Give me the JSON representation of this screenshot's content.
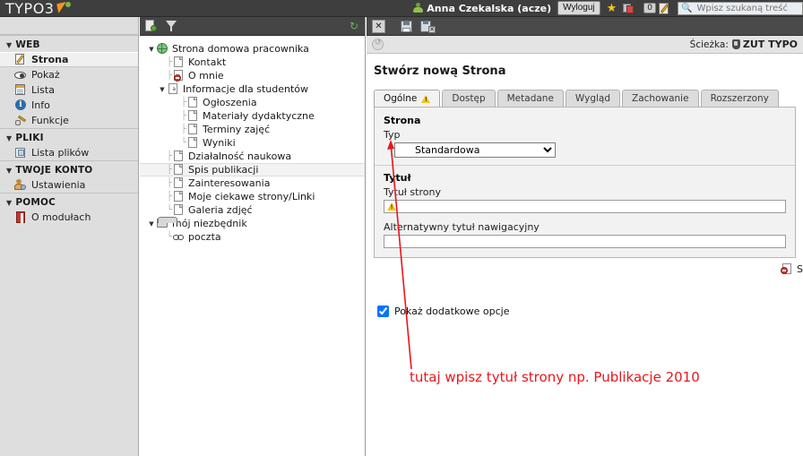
{
  "header": {
    "logo_text": "TYPO3",
    "logo_icon": "typo3-logo-icon",
    "user_icon": "user-icon",
    "user_name": "Anna Czekalska (acze)",
    "logout_label": "Wyloguj",
    "bookmark_icon": "star-icon",
    "clipboard_icon": "clipboard-icon",
    "clipboard_count": "0",
    "edit_icon": "pencil-icon",
    "search_icon": "search-icon",
    "search_placeholder": "Wpisz szukaną treść",
    "search_value": ""
  },
  "sidebar": {
    "groups": [
      {
        "label": "WEB",
        "items": [
          {
            "label": "Strona",
            "icon": "page-edit-icon",
            "selected": true
          },
          {
            "label": "Pokaż",
            "icon": "eye-icon",
            "selected": false
          },
          {
            "label": "Lista",
            "icon": "list-icon",
            "selected": false
          },
          {
            "label": "Info",
            "icon": "info-icon",
            "selected": false
          },
          {
            "label": "Funkcje",
            "icon": "wrench-icon",
            "selected": false
          }
        ]
      },
      {
        "label": "PLIKI",
        "items": [
          {
            "label": "Lista plików",
            "icon": "file-list-icon",
            "selected": false
          }
        ]
      },
      {
        "label": "TWOJE KONTO",
        "items": [
          {
            "label": "Ustawienia",
            "icon": "user-settings-icon",
            "selected": false
          }
        ]
      },
      {
        "label": "POMOC",
        "items": [
          {
            "label": "O modułach",
            "icon": "book-icon",
            "selected": false
          }
        ]
      }
    ]
  },
  "tree": {
    "toolbar": {
      "new_page_icon": "new-page-icon",
      "filter_icon": "filter-icon",
      "refresh_icon": "refresh-icon"
    },
    "nodes": [
      {
        "label": "Strona domowa pracownika",
        "icon": "globe-icon",
        "depth": 0,
        "toggle": "▼",
        "selected": false
      },
      {
        "label": "Kontakt",
        "icon": "page-icon",
        "depth": 1,
        "toggle": "",
        "selected": false
      },
      {
        "label": "O mnie",
        "icon": "page-hidden-icon",
        "depth": 1,
        "toggle": "",
        "selected": false
      },
      {
        "label": "Informacje dla studentów",
        "icon": "page-alias-icon",
        "depth": 1,
        "toggle": "▼",
        "selected": false
      },
      {
        "label": "Ogłoszenia",
        "icon": "page-icon",
        "depth": 2,
        "toggle": "",
        "selected": false
      },
      {
        "label": "Materiały dydaktyczne",
        "icon": "page-icon",
        "depth": 2,
        "toggle": "",
        "selected": false
      },
      {
        "label": "Terminy zajęć",
        "icon": "page-icon",
        "depth": 2,
        "toggle": "",
        "selected": false
      },
      {
        "label": "Wyniki",
        "icon": "page-icon",
        "depth": 2,
        "toggle": "",
        "selected": false
      },
      {
        "label": "Działalność naukowa",
        "icon": "page-icon",
        "depth": 1,
        "toggle": "",
        "selected": false
      },
      {
        "label": "Spis publikacji",
        "icon": "page-icon",
        "depth": 1,
        "toggle": "",
        "selected": true
      },
      {
        "label": "Zainteresowania",
        "icon": "page-icon",
        "depth": 1,
        "toggle": "",
        "selected": false
      },
      {
        "label": "Moje ciekawe strony/Linki",
        "icon": "page-icon",
        "depth": 1,
        "toggle": "",
        "selected": false
      },
      {
        "label": "Galeria zdjęć",
        "icon": "page-icon",
        "depth": 1,
        "toggle": "",
        "selected": false
      },
      {
        "label": "mój niezbędnik",
        "icon": "folder-icon",
        "depth": 0,
        "toggle": "▼",
        "selected": false
      },
      {
        "label": "poczta",
        "icon": "link-icon",
        "depth": 1,
        "toggle": "",
        "selected": false
      }
    ]
  },
  "doc": {
    "toolbar": {
      "close_icon": "close-icon",
      "close_label": "✕",
      "save_icon": "save-icon",
      "save_close_icon": "save-and-close-icon"
    },
    "pathbar": {
      "history_icon": "history-icon",
      "path_label": "Ścieżka:",
      "site_icon": "site-shield-icon",
      "site_name": "ZUT TYPO"
    },
    "title": "Stwórz nową Strona",
    "tabs": [
      {
        "label": "Ogólne",
        "active": true,
        "warning": true
      },
      {
        "label": "Dostęp",
        "active": false,
        "warning": false
      },
      {
        "label": "Metadane",
        "active": false,
        "warning": false
      },
      {
        "label": "Wygląd",
        "active": false,
        "warning": false
      },
      {
        "label": "Zachowanie",
        "active": false,
        "warning": false
      },
      {
        "label": "Rozszerzony",
        "active": false,
        "warning": false
      }
    ],
    "form": {
      "section_page_label": "Strona",
      "type_label": "Typ",
      "type_value": "Standardowa",
      "type_options": [
        "Standardowa"
      ],
      "section_title_label": "Tytuł",
      "page_title_label": "Tytuł strony",
      "page_title_value": "",
      "page_title_warning_icon": "warning-icon",
      "nav_title_label": "Alternatywny tytuł nawigacyjny",
      "nav_title_value": "",
      "hidden_icon": "page-hidden-icon",
      "hidden_label": "S",
      "show_more_label": "Pokaż dodatkowe opcje",
      "show_more_checked": true
    },
    "annotation": {
      "text": "tutaj wpisz tytuł strony np. Publikacje 2010",
      "color": "#e8161b"
    }
  },
  "colors": {
    "header_bg": "#3e3e3e",
    "sidebar_bg": "#dedede",
    "toolbar_bg": "#4a4a4a",
    "accent_orange": "#f7931e",
    "accent_green": "#7ab648",
    "annotation_red": "#e8161b",
    "warning_yellow": "#f0c419"
  }
}
